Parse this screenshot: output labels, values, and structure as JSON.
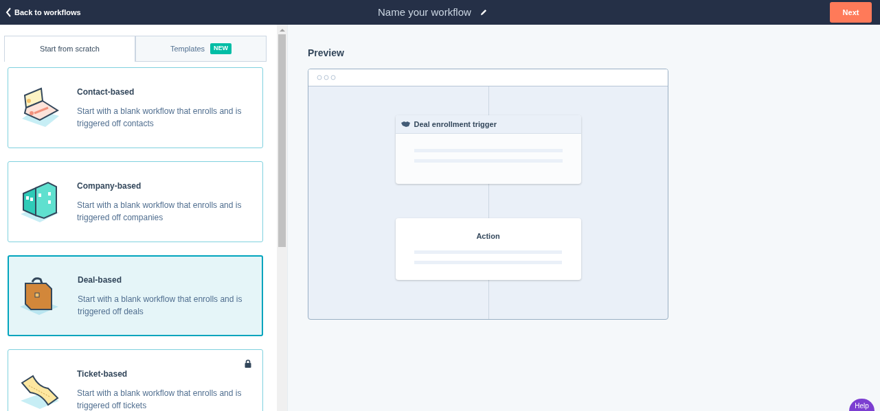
{
  "header": {
    "back_link": "Back to workflows",
    "title": "Name your workflow",
    "next_button": "Next"
  },
  "tabs": [
    {
      "label": "Start from scratch",
      "selected": true
    },
    {
      "label": "Templates",
      "selected": false,
      "badge": "NEW"
    }
  ],
  "cards": [
    {
      "kind": "contact",
      "title": "Contact-based",
      "description": "Start with a blank workflow that enrolls and is triggered off contacts",
      "selected": false,
      "locked": false
    },
    {
      "kind": "company",
      "title": "Company-based",
      "description": "Start with a blank workflow that enrolls and is triggered off companies",
      "selected": false,
      "locked": false
    },
    {
      "kind": "deal",
      "title": "Deal-based",
      "description": "Start with a blank workflow that enrolls and is triggered off deals",
      "selected": true,
      "locked": false
    },
    {
      "kind": "ticket",
      "title": "Ticket-based",
      "description": "Start with a blank workflow that enrolls and is triggered off tickets",
      "selected": false,
      "locked": true
    }
  ],
  "preview": {
    "heading": "Preview",
    "trigger_title": "Deal enrollment trigger",
    "action_title": "Action"
  },
  "help_button": "Help"
}
